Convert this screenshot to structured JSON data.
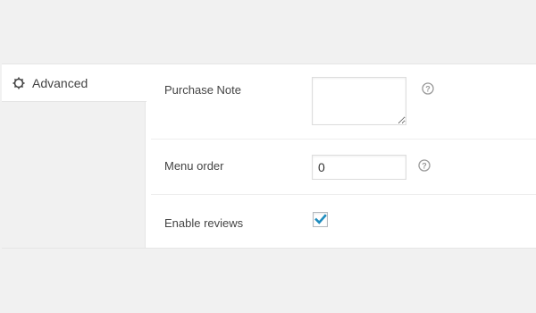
{
  "tabs": [
    {
      "label": "Advanced",
      "icon": "gear-icon",
      "active": true
    }
  ],
  "fields": {
    "purchase_note": {
      "label": "Purchase Note",
      "value": ""
    },
    "menu_order": {
      "label": "Menu order",
      "value": "0"
    },
    "enable_reviews": {
      "label": "Enable reviews",
      "checked": true
    }
  },
  "colors": {
    "checkmark": "#1e8cbe",
    "help_icon": "#999999",
    "background": "#f1f1f1"
  }
}
